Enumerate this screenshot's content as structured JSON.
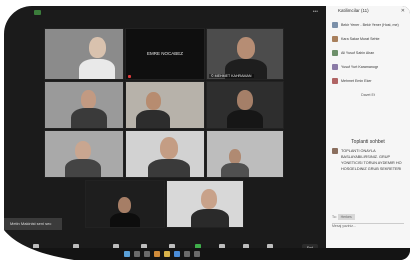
{
  "meeting": {
    "view_label": "•••"
  },
  "tiles": [
    {
      "name": ""
    },
    {
      "name": "",
      "center_name": "EMRE NOCABEZ"
    },
    {
      "name": "© MEHMET KAHRAMAN"
    },
    {
      "name": ""
    },
    {
      "name": ""
    },
    {
      "name": ""
    },
    {
      "name": ""
    },
    {
      "name": ""
    },
    {
      "name": ""
    },
    {
      "name": ""
    },
    {
      "name": ""
    }
  ],
  "controls": [
    {
      "label": "Mute"
    },
    {
      "label": "Start Video"
    },
    {
      "label": "Security"
    },
    {
      "label": "Participants"
    },
    {
      "label": "Chat"
    },
    {
      "label": "Share Screen"
    },
    {
      "label": "Record"
    },
    {
      "label": "Reactions"
    },
    {
      "label": "Apps"
    }
  ],
  "end_label": "End",
  "toast": "Metin Makinist seni sec",
  "sidebar": {
    "title": "Katilimcilar (11)",
    "close": "✕",
    "participants": [
      {
        "name": "Bekir Yener - Bekir Yener (Host, me)"
      },
      {
        "name": "Kara Sakar Murat Sehte"
      },
      {
        "name": "Ali Yusuf Sahin Ahan"
      },
      {
        "name": "Yusuf Yurt Karamanogr"
      },
      {
        "name": "Mehmet Emin Eker"
      }
    ],
    "invite": "Davet Et"
  },
  "chat": {
    "title": "Toplanti sohbet",
    "message": "TOPLANTI ONAYLA BASLAYABILIRSINIZ. GRUP YONETICISI TORUN AYDEMIR HO HOSGELDINIZ GRUB SEKRETERI",
    "to_label": "To:",
    "to_value": "Herkes",
    "input_placeholder": "Mesaj yaziniz..."
  }
}
